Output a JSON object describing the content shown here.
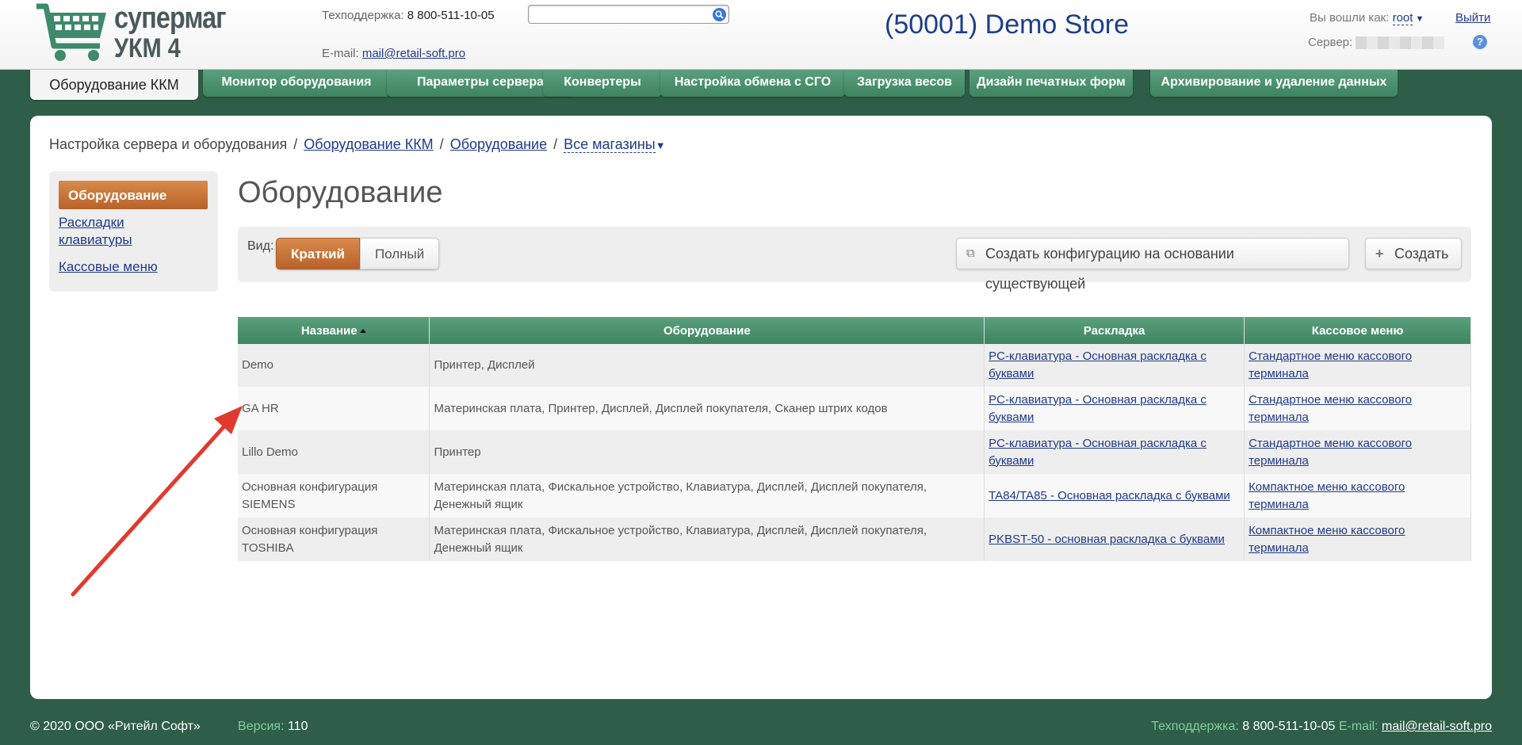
{
  "header": {
    "logo_line1": "супермаг",
    "logo_line2": "УКМ 4",
    "support_label": "Техподдержка:",
    "support_phone": "8 800-511-10-05",
    "email_label": "E-mail:",
    "email": "mail@retail-soft.pro",
    "search_value": "",
    "store_title": "(50001) Demo Store",
    "logged_in_label": "Вы вошли как:",
    "username": "root",
    "logout": "Выйти",
    "server_label": "Сервер:"
  },
  "nav": {
    "items": [
      {
        "label": "Оборудование ККМ",
        "active": true
      },
      {
        "label": "Монитор оборудования"
      },
      {
        "label": "Параметры сервера"
      },
      {
        "label": "Конвертеры"
      },
      {
        "label": "Настройка обмена с СГО"
      },
      {
        "label": "Загрузка весов"
      },
      {
        "label": "Дизайн печатных форм"
      },
      {
        "label": "Архивирование и удаление данных"
      }
    ]
  },
  "breadcrumb": {
    "root": "Настройка сервера и оборудования",
    "level1": "Оборудование ККМ",
    "level2": "Оборудование",
    "stores": "Все магазины"
  },
  "sidebar": {
    "items": [
      {
        "label": "Оборудование"
      },
      {
        "label": "Раскладки клавиатуры"
      },
      {
        "label": "Кассовые меню"
      }
    ]
  },
  "page_title": "Оборудование",
  "toolbar": {
    "view_label": "Вид:",
    "view_short": "Краткий",
    "view_full": "Полный",
    "create_from_existing": "Создать конфигурацию на основании существующей",
    "create": "Создать"
  },
  "table": {
    "headers": [
      "Название",
      "Оборудование",
      "Раскладка",
      "Кассовое меню"
    ],
    "rows": [
      {
        "name": "Demo",
        "equipment": "Принтер, Дисплей",
        "layout": "PC-клавиатура - Основная раскладка с буквами",
        "menu": "Стандартное меню кассового терминала"
      },
      {
        "name": "GA HR",
        "equipment": "Материнская плата, Принтер, Дисплей, Дисплей покупателя, Сканер штрих кодов",
        "layout": "PC-клавиатура - Основная раскладка с буквами",
        "menu": "Стандартное меню кассового терминала"
      },
      {
        "name": "Lillo Demo",
        "equipment": "Принтер",
        "layout": "PC-клавиатура - Основная раскладка с буквами",
        "menu": "Стандартное меню кассового терминала"
      },
      {
        "name": "Основная конфигурация SIEMENS",
        "equipment": "Материнская плата, Фискальное устройство, Клавиатура, Дисплей, Дисплей покупателя, Денежный ящик",
        "layout": "TA84/TA85 - Основная раскладка с буквами",
        "menu": "Компактное меню кассового терминала"
      },
      {
        "name": "Основная конфигурация TOSHIBA",
        "equipment": "Материнская плата, Фискальное устройство, Клавиатура, Дисплей, Дисплей покупателя, Денежный ящик",
        "layout": "PKBST-50 - основная раскладка с буквами",
        "menu": "Компактное меню кассового терминала"
      }
    ]
  },
  "footer": {
    "copyright": "© 2020 ООО «Ритейл Софт»",
    "version_label": "Версия:",
    "version": "110",
    "support_label": "Техподдержка:",
    "support_phone": "8 800-511-10-05",
    "email_label": "E-mail:",
    "email": "mail@retail-soft.pro"
  },
  "colors": {
    "background": "#2f5e48",
    "nav_green": "#4a9270",
    "active_orange": "#c8713a",
    "link": "#1f3a8a",
    "arrow": "#e03a2f"
  }
}
